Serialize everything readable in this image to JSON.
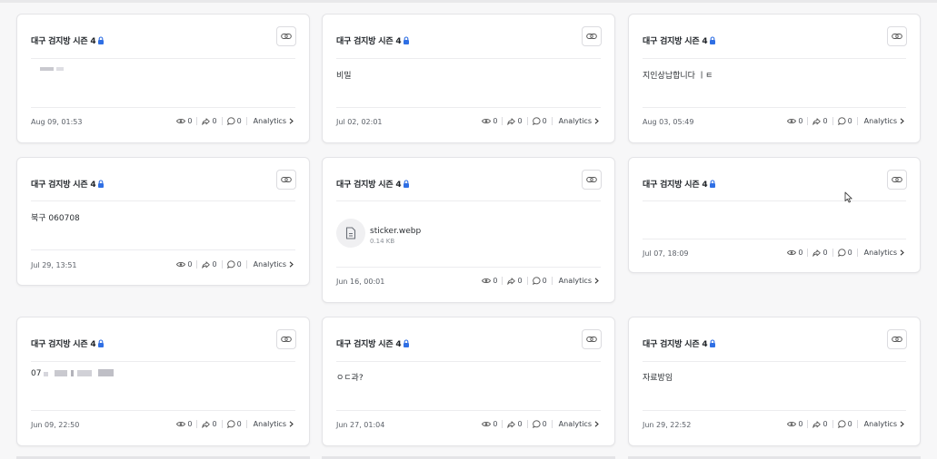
{
  "cards": [
    {
      "title": "대구 검지방 시즌 4",
      "content": "",
      "date": "Aug 09, 01:53",
      "views": "0",
      "shares": "0",
      "comments": "0",
      "analytics": "Analytics"
    },
    {
      "title": "대구 검지방 시즌 4",
      "content": "비밀",
      "date": "Jul 02, 02:01",
      "views": "0",
      "shares": "0",
      "comments": "0",
      "analytics": "Analytics"
    },
    {
      "title": "대구 검지방 시즌 4",
      "content": "지인상납합니다 ㅣㅌ",
      "date": "Aug 03, 05:49",
      "views": "0",
      "shares": "0",
      "comments": "0",
      "analytics": "Analytics"
    },
    {
      "title": "대구 검지방 시즌 4",
      "content": "북구 060708",
      "date": "Jul 29, 13:51",
      "views": "0",
      "shares": "0",
      "comments": "0",
      "analytics": "Analytics"
    },
    {
      "title": "대구 검지방 시즌 4",
      "content": "",
      "file_name": "sticker.webp",
      "file_size": "0.14 KB",
      "date": "Jun 16, 00:01",
      "views": "0",
      "shares": "0",
      "comments": "0",
      "analytics": "Analytics"
    },
    {
      "title": "대구 검지방 시즌 4",
      "content": "",
      "date": "Jul 07, 18:09",
      "views": "0",
      "shares": "0",
      "comments": "0",
      "analytics": "Analytics"
    },
    {
      "title": "대구 검지방 시즌 4",
      "content": "07",
      "date": "Jun 09, 22:50",
      "views": "0",
      "shares": "0",
      "comments": "0",
      "analytics": "Analytics"
    },
    {
      "title": "대구 검지방 시즌 4",
      "content": "ㅇㄷ과?",
      "date": "Jun 27, 01:04",
      "views": "0",
      "shares": "0",
      "comments": "0",
      "analytics": "Analytics"
    },
    {
      "title": "대구 검지방 시즌 4",
      "content": "자료방임",
      "date": "Jun 29, 22:52",
      "views": "0",
      "shares": "0",
      "comments": "0",
      "analytics": "Analytics"
    }
  ],
  "colors": {
    "accent": "#2f6fe4",
    "border": "#e4e4e7",
    "background": "#f7f7f8"
  }
}
